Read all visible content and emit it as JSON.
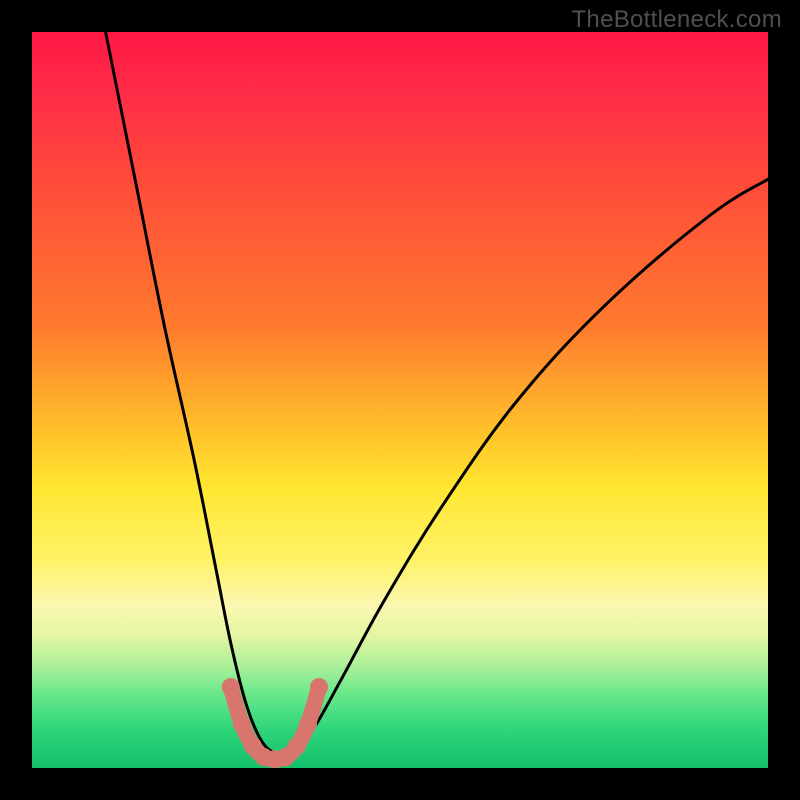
{
  "watermark": "TheBottleneck.com",
  "chart_data": {
    "type": "line",
    "title": "",
    "xlabel": "",
    "ylabel": "",
    "xlim": [
      0,
      100
    ],
    "ylim": [
      0,
      100
    ],
    "annotations": [],
    "series": [
      {
        "name": "bottleneck-curve-main",
        "x": [
          10,
          14,
          18,
          22,
          25,
          27,
          29,
          31,
          33,
          35,
          38,
          42,
          48,
          56,
          66,
          78,
          92,
          100
        ],
        "y": [
          100,
          80,
          60,
          42,
          27,
          17,
          9,
          4,
          2,
          2,
          5,
          12,
          23,
          36,
          50,
          63,
          75,
          80
        ]
      },
      {
        "name": "bottleneck-curve-secondary",
        "x": [
          27,
          28.5,
          30,
          31.5,
          33,
          34.5,
          36,
          37.5,
          39
        ],
        "y": [
          11,
          6,
          3,
          1.5,
          1.2,
          1.5,
          3,
          6,
          11
        ]
      }
    ],
    "marker_points": {
      "x": [
        27,
        28.5,
        30,
        31.5,
        33,
        34.5,
        36,
        37.5,
        39
      ],
      "y": [
        11,
        6,
        3,
        1.5,
        1.2,
        1.5,
        3,
        6,
        11
      ]
    },
    "gradient_stops": [
      {
        "pct": 0,
        "color": "#ff1744"
      },
      {
        "pct": 40,
        "color": "#ff7a2e"
      },
      {
        "pct": 62,
        "color": "#ffe731"
      },
      {
        "pct": 82,
        "color": "#e4f6a3"
      },
      {
        "pct": 100,
        "color": "#15c06b"
      }
    ]
  }
}
